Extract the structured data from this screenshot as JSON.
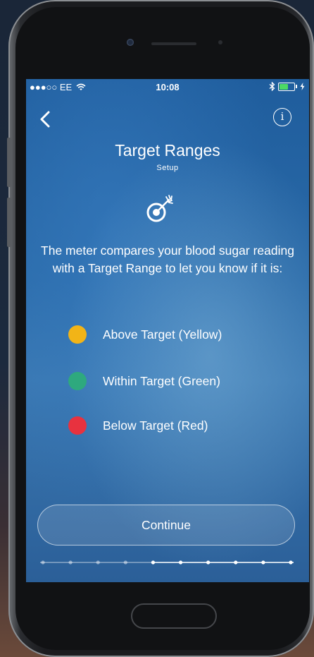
{
  "status_bar": {
    "carrier": "●●●○○ EE",
    "time": "10:08"
  },
  "header": {
    "title": "Target Ranges",
    "subtitle": "Setup"
  },
  "description": "The meter compares your blood sugar reading with a Target Range to let you know if it is:",
  "legend": [
    {
      "label": "Above Target (Yellow)",
      "color": "#f2b417"
    },
    {
      "label": "Within Target (Green)",
      "color": "#2ea97e"
    },
    {
      "label": "Below Target (Red)",
      "color": "#e8323f"
    }
  ],
  "continue_label": "Continue",
  "progress": {
    "total_steps": 10,
    "current_step": 5
  },
  "icons": {
    "back": "chevron-left-icon",
    "info": "info-icon",
    "target": "target-arrow-icon"
  }
}
